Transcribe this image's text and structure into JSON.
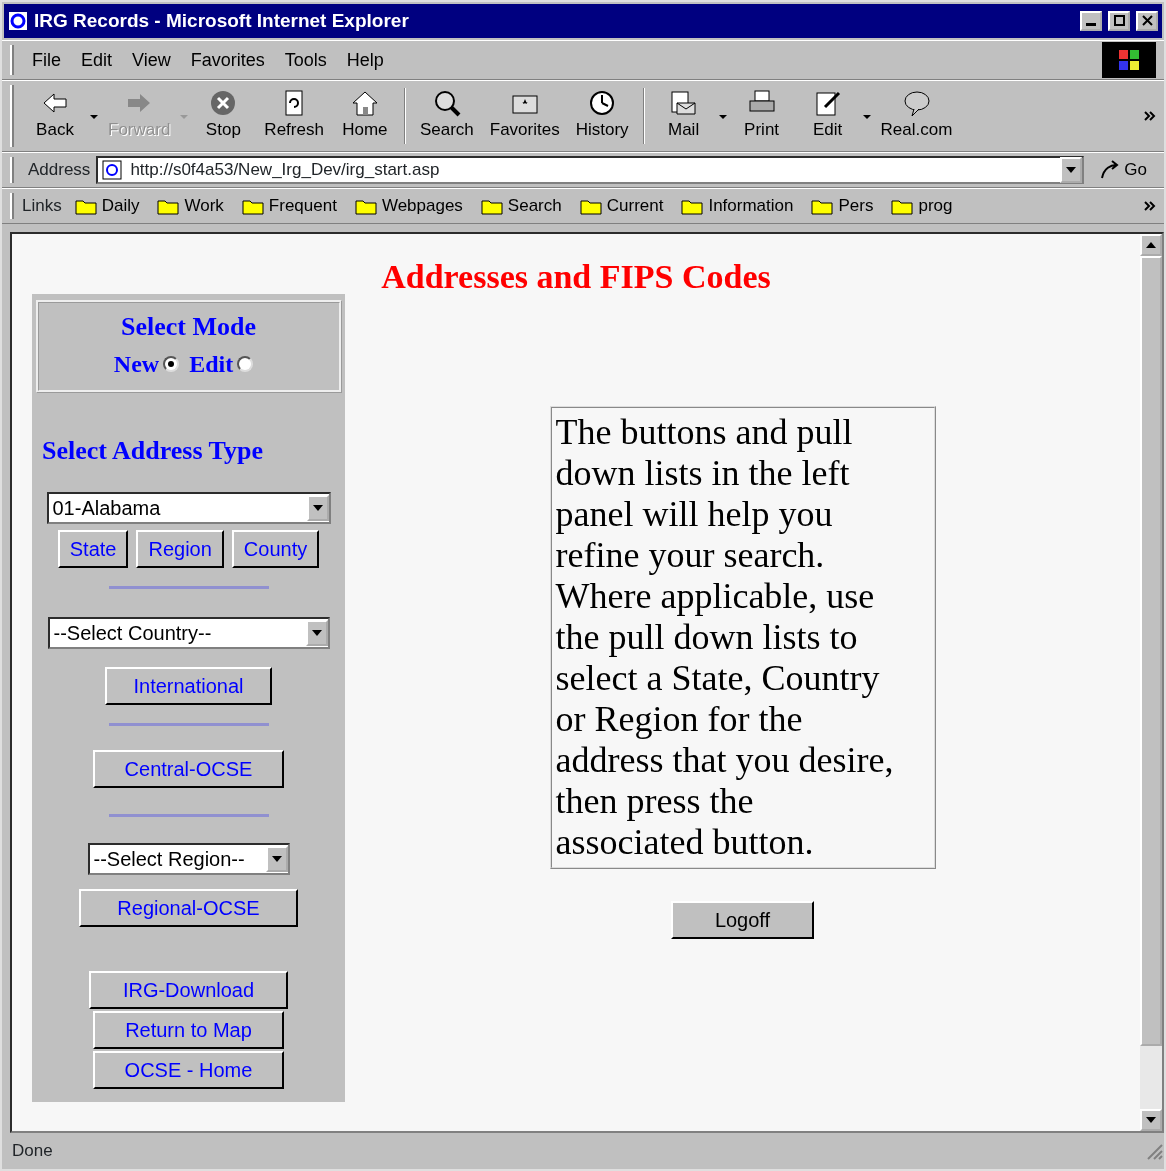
{
  "window": {
    "title": "IRG Records - Microsoft Internet Explorer"
  },
  "menu": [
    "File",
    "Edit",
    "View",
    "Favorites",
    "Tools",
    "Help"
  ],
  "toolbar": [
    {
      "label": "Back",
      "disabled": false,
      "dropdown": true
    },
    {
      "label": "Forward",
      "disabled": true,
      "dropdown": true
    },
    {
      "label": "Stop",
      "disabled": false,
      "dropdown": false
    },
    {
      "label": "Refresh",
      "disabled": false,
      "dropdown": false
    },
    {
      "label": "Home",
      "disabled": false,
      "dropdown": false
    },
    {
      "label": "Search",
      "disabled": false,
      "dropdown": false
    },
    {
      "label": "Favorites",
      "disabled": false,
      "dropdown": false
    },
    {
      "label": "History",
      "disabled": false,
      "dropdown": false
    },
    {
      "label": "Mail",
      "disabled": false,
      "dropdown": true
    },
    {
      "label": "Print",
      "disabled": false,
      "dropdown": false
    },
    {
      "label": "Edit",
      "disabled": false,
      "dropdown": true
    },
    {
      "label": "Real.com",
      "disabled": false,
      "dropdown": false
    }
  ],
  "address": {
    "label": "Address",
    "url": "http://s0f4a53/New_Irg_Dev/irg_start.asp",
    "go": "Go"
  },
  "links": {
    "label": "Links",
    "items": [
      "Daily",
      "Work",
      "Frequent",
      "Webpages",
      "Search",
      "Current",
      "Information",
      "Pers",
      "prog"
    ]
  },
  "page": {
    "heading": "Addresses and FIPS Codes",
    "mode": {
      "title": "Select Mode",
      "options": [
        {
          "label": "New",
          "selected": true
        },
        {
          "label": "Edit",
          "selected": false
        }
      ]
    },
    "address_type_title": "Select Address Type",
    "state_select": "01-Alabama",
    "type_buttons": [
      "State",
      "Region",
      "County"
    ],
    "country_select": "--Select Country--",
    "international_button": "International",
    "central_button": "Central-OCSE",
    "region_select": "--Select Region--",
    "regional_button": "Regional-OCSE",
    "bottom_buttons": [
      "IRG-Download",
      "Return to Map",
      "OCSE - Home"
    ],
    "info_text": "The buttons and pull down lists in the left panel will help you refine your search. Where applicable, use the pull down lists to select a State, Country or Region for the address that you desire, then press the associated button.",
    "logoff": "Logoff"
  },
  "status_bar": {
    "text": "Done"
  }
}
